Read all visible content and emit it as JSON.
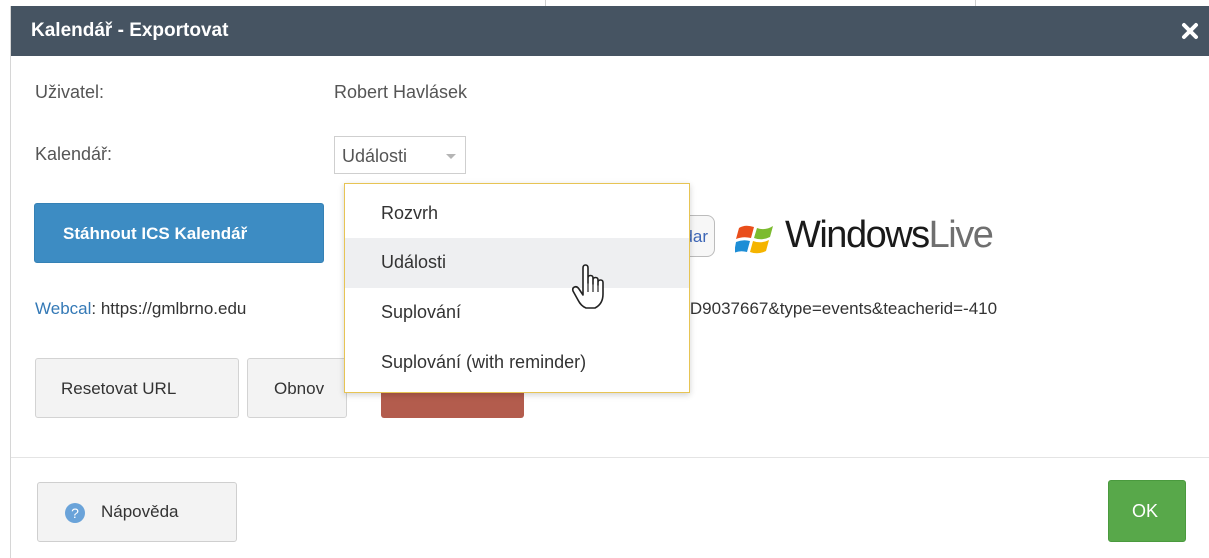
{
  "dialog": {
    "title": "Kalendář - Exportovat",
    "close_icon": "close-icon"
  },
  "form": {
    "user_label": "Uživatel:",
    "user_value": "Robert Havlásek",
    "calendar_label": "Kalendář:",
    "calendar_selected": "Události"
  },
  "dropdown": {
    "options": [
      "Rozvrh",
      "Události",
      "Suplování",
      "Suplování (with reminder)"
    ],
    "selected_index": 1
  },
  "export": {
    "download_ics_label": "Stáhnout ICS Kalendář",
    "google_partial_label": "dar",
    "windows_live_word": "Windows",
    "windows_live_live": "Live"
  },
  "webcal": {
    "link_label": "Webcal",
    "separator": ":",
    "url_visible_start": " https://gmlbrno.edu",
    "url_visible_end": "00D9037667&type=events&teacherid=-410"
  },
  "actions": {
    "reset_url_label": "Resetovat URL",
    "refresh_partial_label": "Obnov"
  },
  "footer": {
    "help_label": "Nápověda",
    "ok_label": "OK"
  },
  "colors": {
    "title_bar": "#465462",
    "primary": "#3d8cc3",
    "danger": "#b35c4d",
    "ok": "#58a84a",
    "link": "#3479b6",
    "dropdown_border": "#e7c454"
  }
}
